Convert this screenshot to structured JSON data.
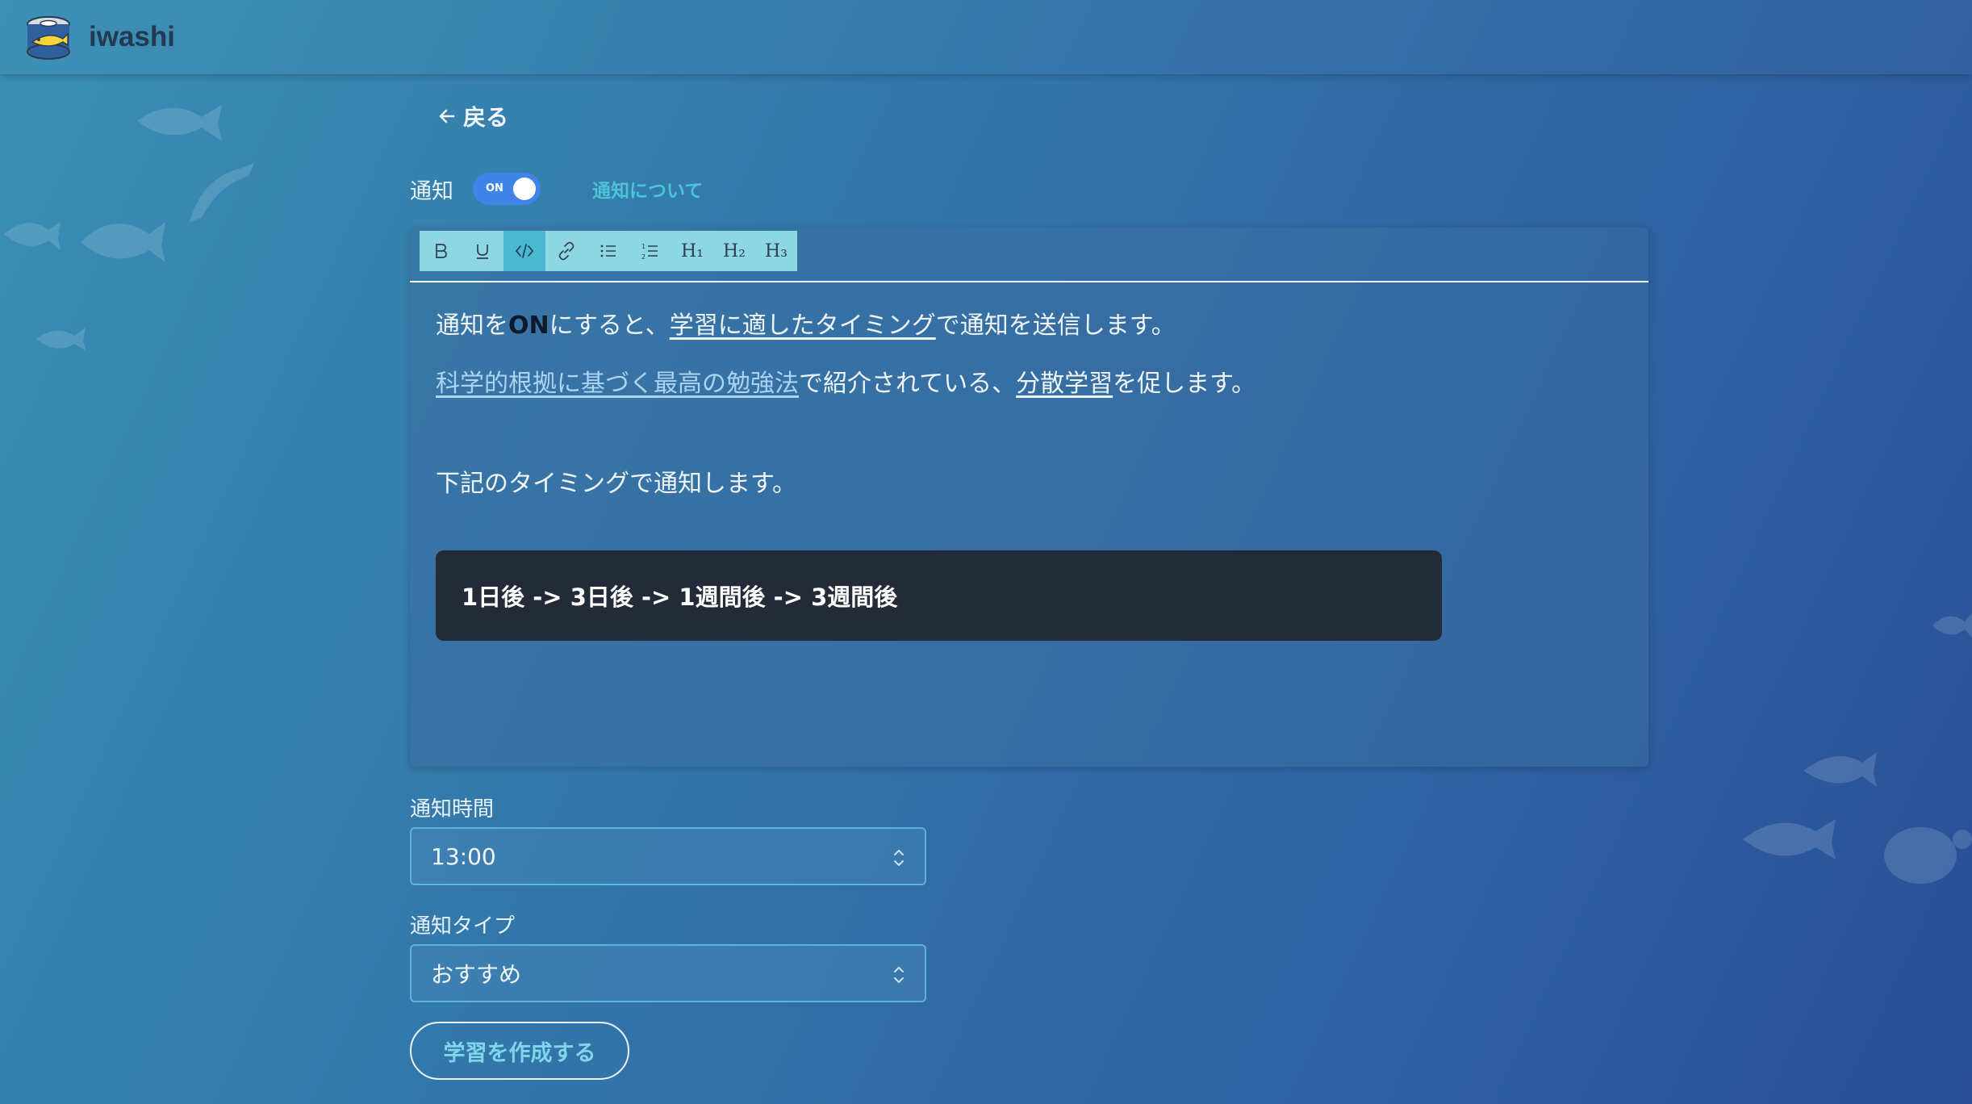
{
  "app": {
    "name": "iwashi"
  },
  "nav": {
    "back_label": "戻る"
  },
  "notification": {
    "label": "通知",
    "toggle_state": "ON",
    "about_link": "通知について"
  },
  "toolbar": {
    "buttons": [
      {
        "name": "bold",
        "glyph": "B"
      },
      {
        "name": "underline",
        "glyph": "U"
      },
      {
        "name": "code",
        "glyph": "</>"
      },
      {
        "name": "link",
        "glyph": "link"
      },
      {
        "name": "bullet-list",
        "glyph": "list"
      },
      {
        "name": "numbered-list",
        "glyph": "olist"
      },
      {
        "name": "heading-1",
        "glyph": "H₁"
      },
      {
        "name": "heading-2",
        "glyph": "H₂"
      },
      {
        "name": "heading-3",
        "glyph": "H₃"
      }
    ],
    "active": "code"
  },
  "editor": {
    "p1_part1": "通知を",
    "p1_on": "ON",
    "p1_part2": "にすると、",
    "p1_link": "学習に適したタイミング",
    "p1_part3": "で通知を送信します。",
    "p2_link1": "科学的根拠に基づく最高の勉強法",
    "p2_part1": "で紹介されている、",
    "p2_link2": "分散学習",
    "p2_part2": "を促します。",
    "p3": "下記のタイミングで通知します。",
    "code": "1日後 -> 3日後 -> 1週間後 -> 3週間後"
  },
  "form": {
    "time_label": "通知時間",
    "time_value": "13:00",
    "type_label": "通知タイプ",
    "type_value": "おすすめ",
    "submit_label": "学習を作成する"
  },
  "colors": {
    "accent": "#3f84e6",
    "link": "#4dc3d6",
    "toolbar": "#8dd7e3",
    "code_bg": "#232a38"
  }
}
